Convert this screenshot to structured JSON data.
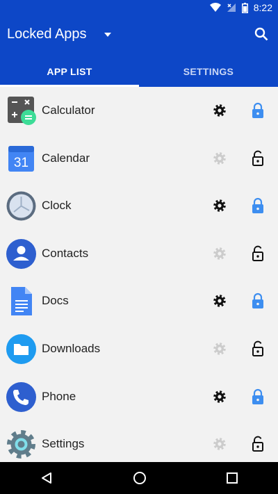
{
  "status_bar": {
    "time": "8:22"
  },
  "toolbar": {
    "title": "Locked Apps"
  },
  "tabs": [
    {
      "label": "APP LIST"
    },
    {
      "label": "SETTINGS"
    }
  ],
  "apps": [
    {
      "name": "Calculator",
      "locked": true
    },
    {
      "name": "Calendar",
      "locked": false
    },
    {
      "name": "Clock",
      "locked": true
    },
    {
      "name": "Contacts",
      "locked": false
    },
    {
      "name": "Docs",
      "locked": true
    },
    {
      "name": "Downloads",
      "locked": false
    },
    {
      "name": "Phone",
      "locked": true
    },
    {
      "name": "Settings",
      "locked": false
    }
  ],
  "calendar_icon_day": "31",
  "colors": {
    "app_bar": "#0d47c7",
    "locked_accent": "#3d8ef0",
    "gear_active": "#111111",
    "gear_inactive": "#cccccc"
  },
  "icons": {
    "status": [
      "wifi-icon",
      "signal-icon",
      "battery-icon"
    ],
    "toolbar": [
      "dropdown-icon",
      "search-icon"
    ],
    "row": [
      "settings-gear-icon",
      "lock-icon"
    ],
    "nav": [
      "back-icon",
      "home-icon",
      "recents-icon"
    ]
  }
}
